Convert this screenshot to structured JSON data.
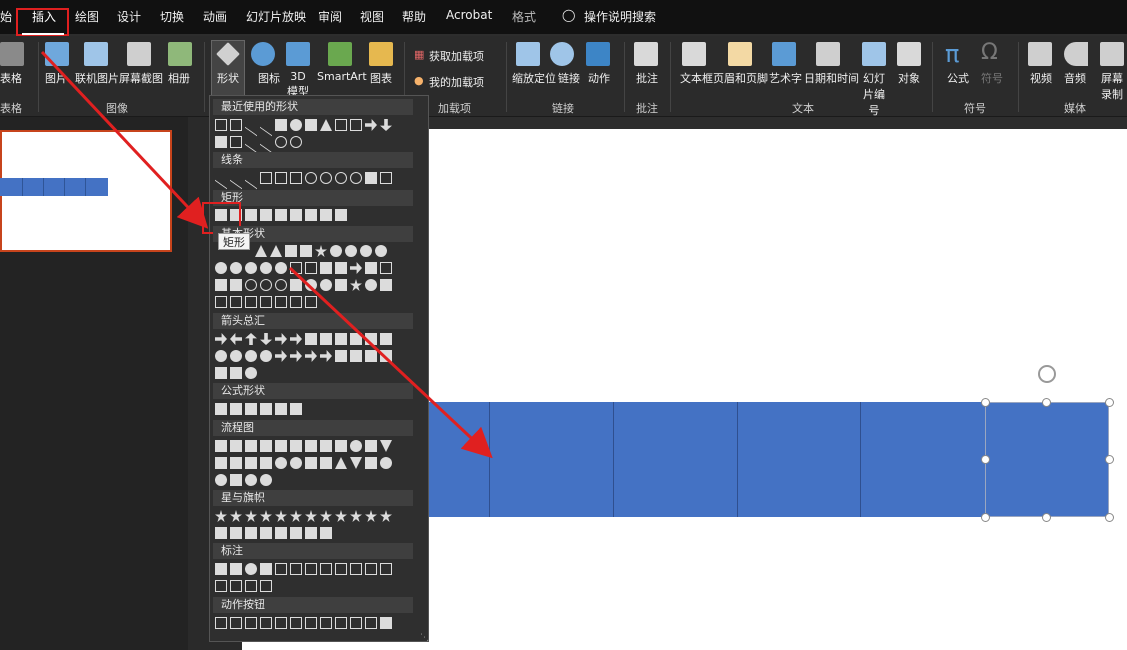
{
  "tabs": [
    "绘图",
    "设计",
    "切换",
    "动画",
    "幻灯片放映",
    "审阅",
    "视图",
    "帮助",
    "Acrobat",
    "格式"
  ],
  "active_tab": "插入",
  "leading_fragment": "始",
  "tell_me": "操作说明搜索",
  "ribbon": {
    "table_label": "表格",
    "buttons": [
      "图片",
      "联机图片",
      "屏幕截图",
      "相册",
      "形状",
      "图标",
      "3D 模型",
      "SmartArt",
      "图表"
    ],
    "addins": [
      "获取加载项",
      "我的加载项"
    ],
    "link_buttons": [
      "缩放定位",
      "链接",
      "动作"
    ],
    "comment_button": "批注",
    "text_buttons": [
      "文本框",
      "页眉和页脚",
      "艺术字",
      "日期和时间",
      "幻灯片编号",
      "对象"
    ],
    "symbol_buttons": [
      "公式",
      "符号"
    ],
    "media_buttons": [
      "视频",
      "音频",
      "屏幕录制"
    ],
    "groups": [
      "表格",
      "图像",
      "加载项",
      "链接",
      "批注",
      "文本",
      "符号",
      "媒体"
    ]
  },
  "shapes_menu": {
    "sections": [
      "最近使用的形状",
      "线条",
      "矩形",
      "基本形状",
      "箭头总汇",
      "公式形状",
      "流程图",
      "星与旗帜",
      "标注",
      "动作按钮"
    ],
    "tooltip": "矩形"
  },
  "colors": {
    "accent_red": "#e02020",
    "shape_blue": "#4472c4",
    "ribbon_bg": "#2b2b2b",
    "slide_bg": "#ffffff"
  }
}
